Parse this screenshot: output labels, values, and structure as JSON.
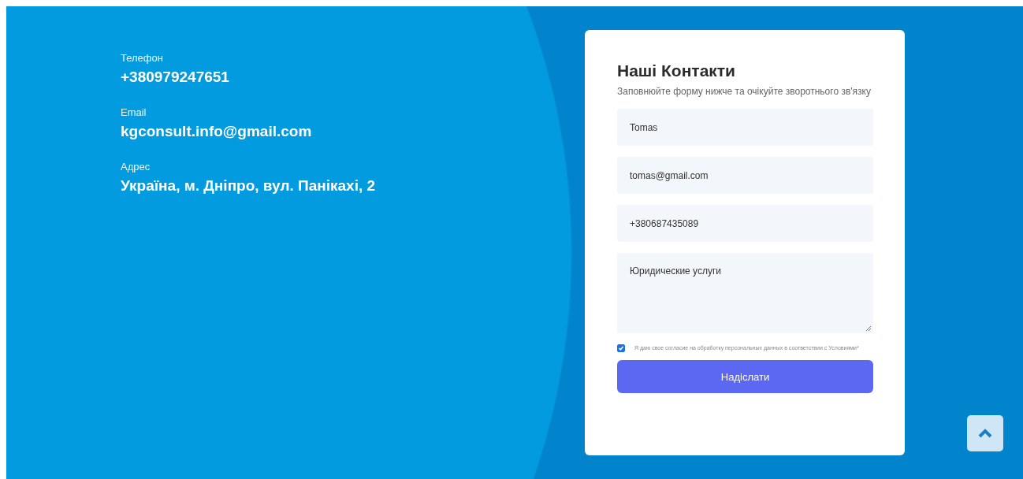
{
  "contacts": [
    {
      "label": "Телефон",
      "value": "+380979247651"
    },
    {
      "label": "Email",
      "value": "kgconsult.info@gmail.com"
    },
    {
      "label": "Адрес",
      "value": "Україна, м. Дніпро, вул. Панікахі, 2"
    }
  ],
  "form": {
    "title": "Наші Контакти",
    "subtitle": "Заповнюйте форму нижче та очікуйте зворотнього зв'язку",
    "fields": [
      {
        "kind": "text",
        "value": "Tomas"
      },
      {
        "kind": "text",
        "value": "tomas@gmail.com"
      },
      {
        "kind": "text",
        "value": "+380687435089"
      },
      {
        "kind": "textarea",
        "value": "Юридические услуги"
      }
    ],
    "consent": {
      "checked": true,
      "text": "Я даю свое согласие на обработку персональных данных в соответствии с Условиями*"
    },
    "submit": "Надіслати"
  }
}
